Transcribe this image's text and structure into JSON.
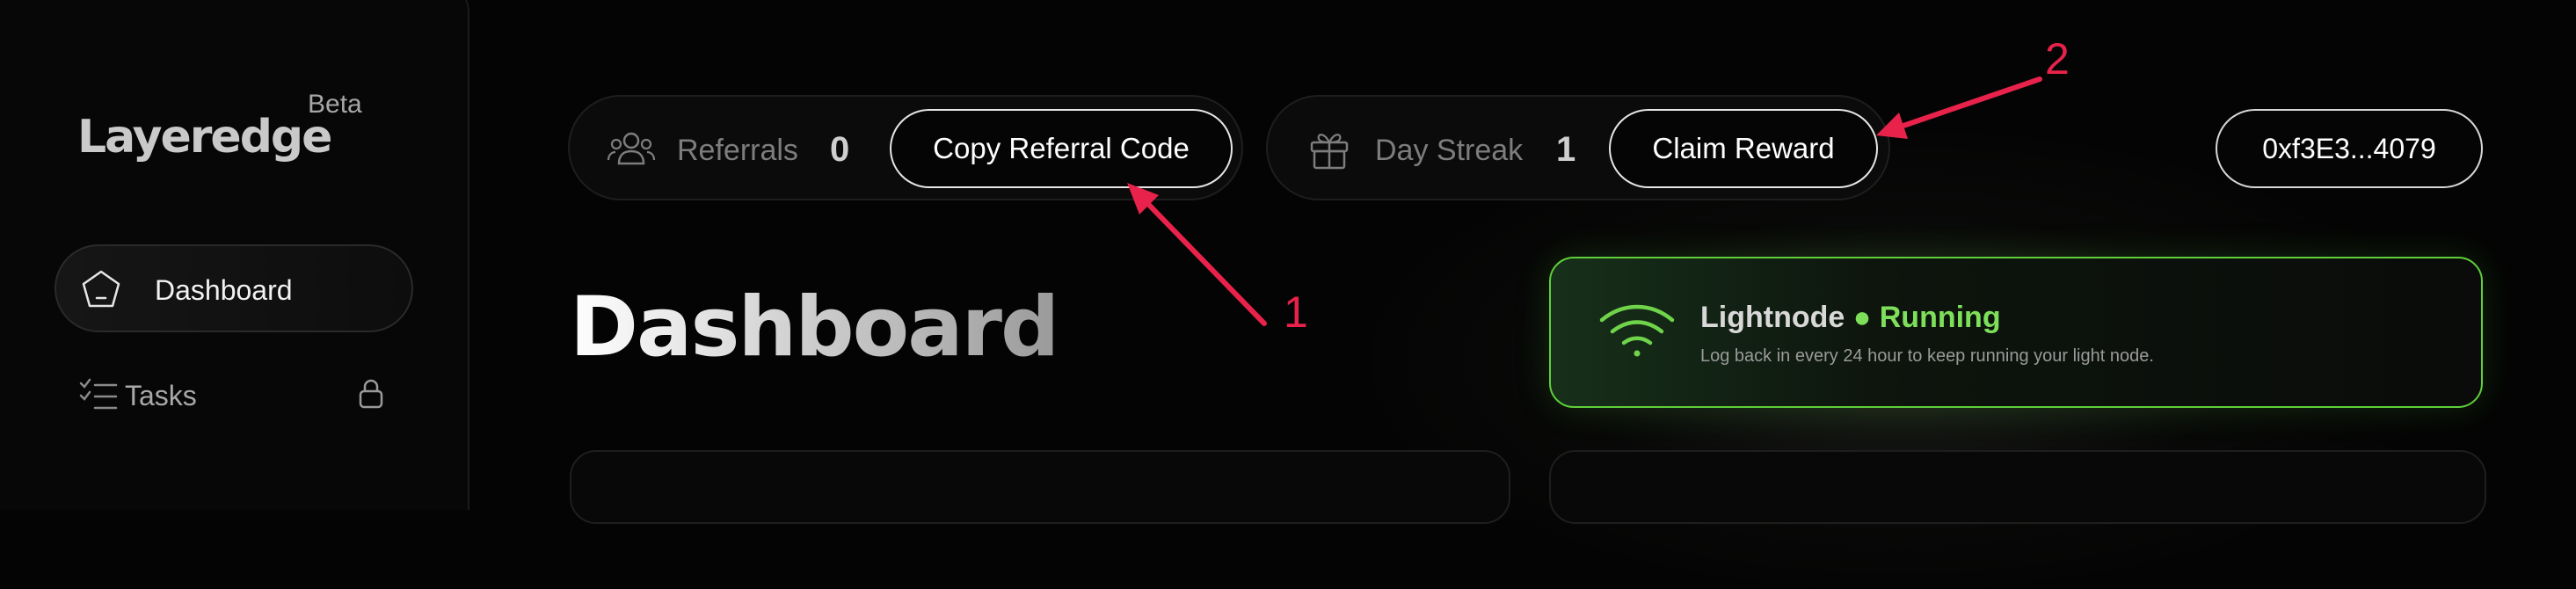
{
  "sidebar": {
    "logo": "Layeredge",
    "beta": "Beta",
    "items": [
      {
        "label": "Dashboard",
        "icon": "pentagon-icon",
        "active": true
      },
      {
        "label": "Tasks",
        "icon": "checklist-icon",
        "locked": true
      }
    ]
  },
  "topbar": {
    "referrals": {
      "label": "Referrals",
      "count": "0",
      "button": "Copy Referral Code",
      "icon": "users-icon"
    },
    "streak": {
      "label": "Day Streak",
      "count": "1",
      "button": "Claim Reward",
      "icon": "gift-icon"
    },
    "wallet": "0xf3E3...4079"
  },
  "main": {
    "title": "Dashboard",
    "lightnode": {
      "name": "Lightnode",
      "status": "Running",
      "message": "Log back in every 24 hour to keep running your light node.",
      "icon": "wifi-icon",
      "status_color": "#7ee05a"
    }
  },
  "annotations": {
    "labels": [
      "1",
      "2"
    ],
    "color": "#e8224a"
  },
  "colors": {
    "accent_green": "#7ee05a",
    "background": "#040404"
  }
}
